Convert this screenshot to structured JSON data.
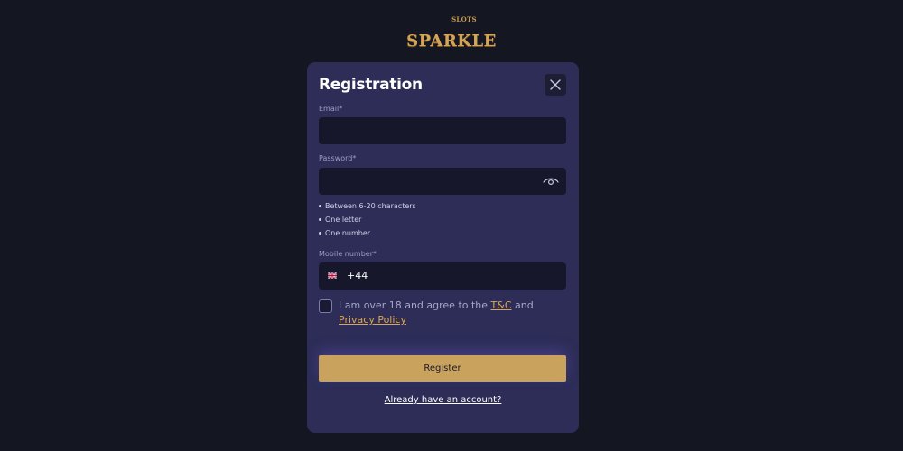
{
  "logo": {
    "main": "SPARKLE",
    "sub": "SLOTS"
  },
  "modal": {
    "title": "Registration",
    "email": {
      "label": "Email*",
      "value": ""
    },
    "password": {
      "label": "Password*",
      "value": "",
      "rules": [
        "Between 6-20 characters",
        "One letter",
        "One number"
      ]
    },
    "mobile": {
      "label": "Mobile number*",
      "country_code": "+44",
      "flag": "uk-flag-icon"
    },
    "terms": {
      "prefix": "I am over 18 and agree to the ",
      "tc_link": "T&C",
      "middle": " and ",
      "privacy_link": "Privacy Policy",
      "checked": false
    },
    "register_label": "Register",
    "login_link": "Already have an account?"
  },
  "colors": {
    "background": "#141621",
    "modal": "#2d2d58",
    "field": "#16172a",
    "accent": "#c9a25e",
    "link": "#d9a657"
  }
}
